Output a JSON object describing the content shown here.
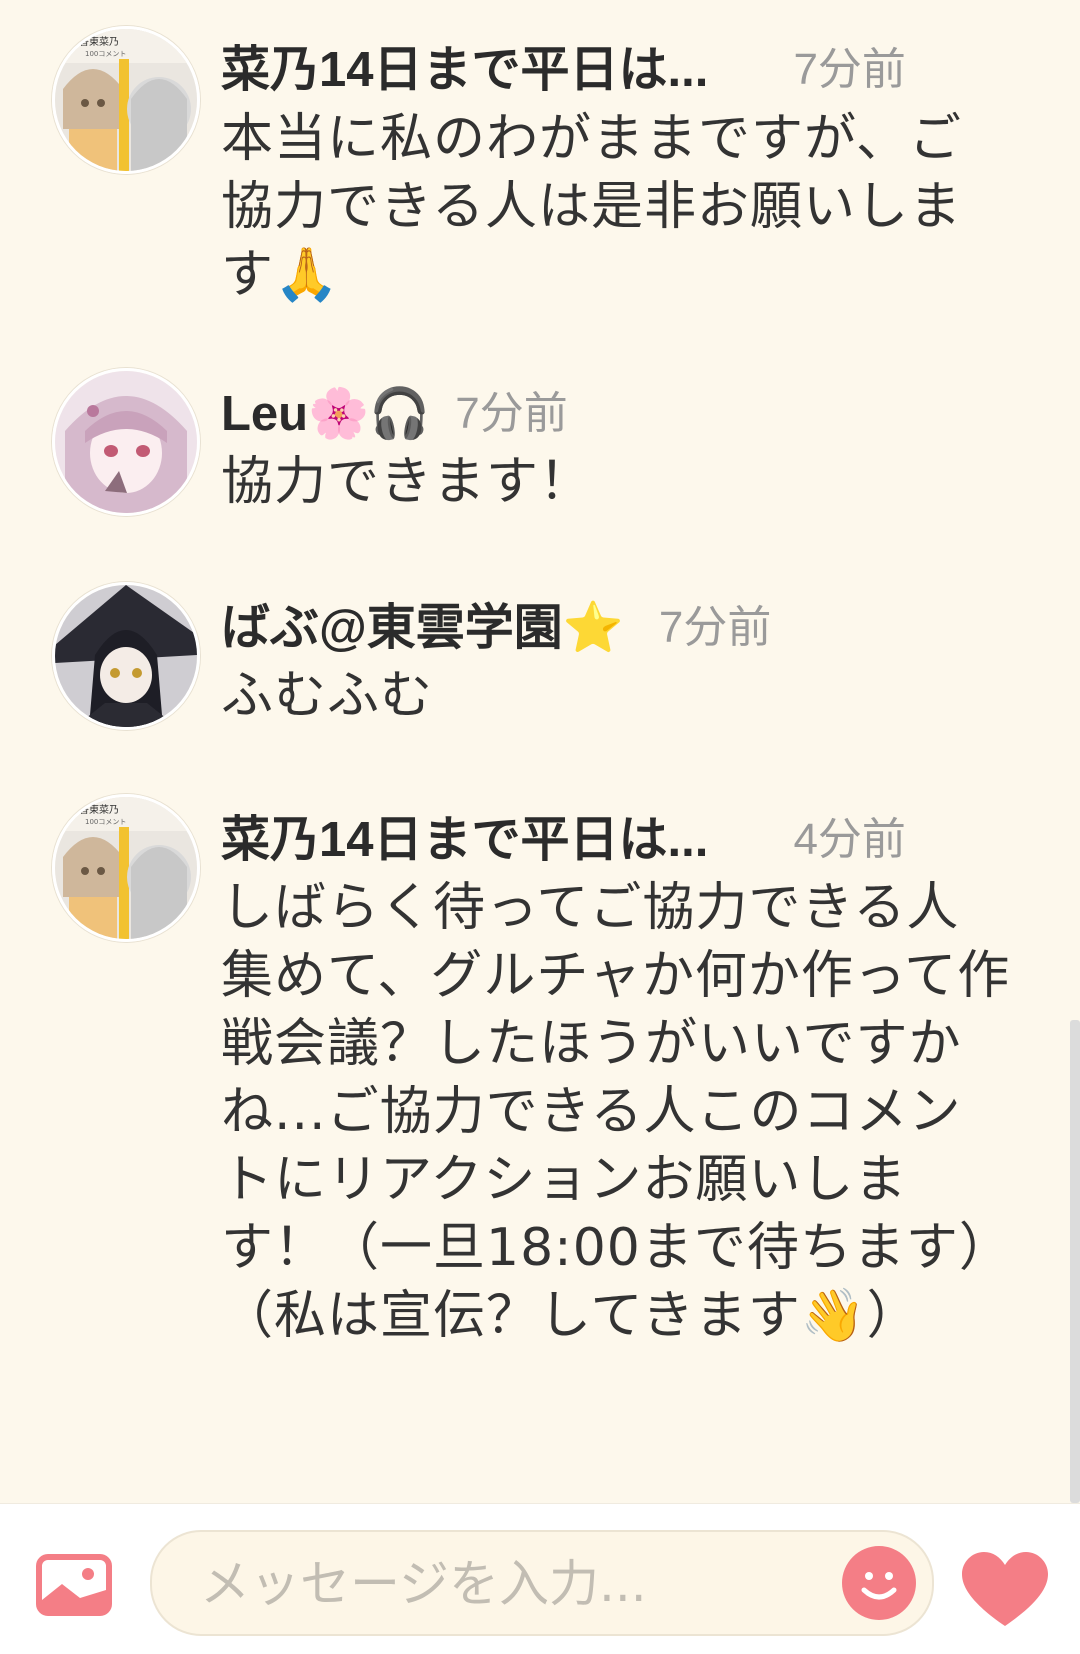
{
  "messages": [
    {
      "name": "菜乃14日まで平日は...",
      "time": "7分前",
      "text": "本当に私のわがままですが、ご協力できる人は是非お願いします🙏"
    },
    {
      "name": "Leu🌸🎧",
      "time": "7分前",
      "text": "協力できます！"
    },
    {
      "name": "ばぶ@東雲学園⭐",
      "time": "7分前",
      "text": "ふむふむ"
    },
    {
      "name": "菜乃14日まで平日は...",
      "time": "4分前",
      "text": "しばらく待ってご協力できる人集めて、グルチャか何か作って作戦会議？したほうがいいですかね...ご協力できる人このコメントにリアクションお願いします！（一旦18:00まで待ちます）（私は宣伝？してきます👋）"
    }
  ],
  "avatar_badge": {
    "text": "香東菜乃",
    "subtext": "100コメント"
  },
  "input": {
    "placeholder": "メッセージを入力..."
  },
  "icons": {
    "image": "image-icon",
    "emoji": "smile-icon",
    "heart": "heart-icon"
  },
  "colors": {
    "background": "#fdf8ec",
    "accent": "#f47e86",
    "time": "#9a9a9a"
  }
}
